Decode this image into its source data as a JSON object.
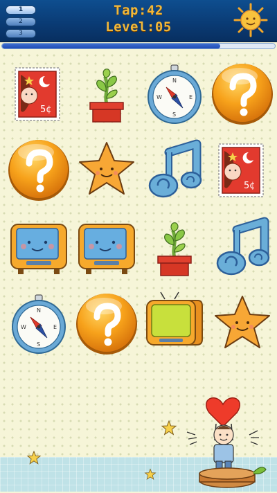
{
  "header": {
    "tap_label": "Tap:",
    "tap_count": "42",
    "level_label": "Level:",
    "level_value": "05",
    "level_tabs": [
      "1",
      "2",
      "3"
    ]
  },
  "progress": {
    "fraction": 0.8
  },
  "board": {
    "rows": [
      [
        "stamp-icon",
        "plant-icon",
        "compass-icon",
        "question-icon"
      ],
      [
        "question-icon",
        "star-icon",
        "music-note-icon",
        "stamp-icon"
      ],
      [
        "tv-blue-icon",
        "tv-blue-icon",
        "plant-icon",
        "music-note-icon"
      ],
      [
        "compass-icon",
        "question-icon",
        "tv-green-icon",
        "star-icon"
      ]
    ]
  },
  "colors": {
    "header": "#0a3a73",
    "text_gold": "#f0b73a",
    "question_orange": "#f7a21b",
    "board_bg": "#f6f5d8",
    "ground": "#bfe2e7"
  }
}
